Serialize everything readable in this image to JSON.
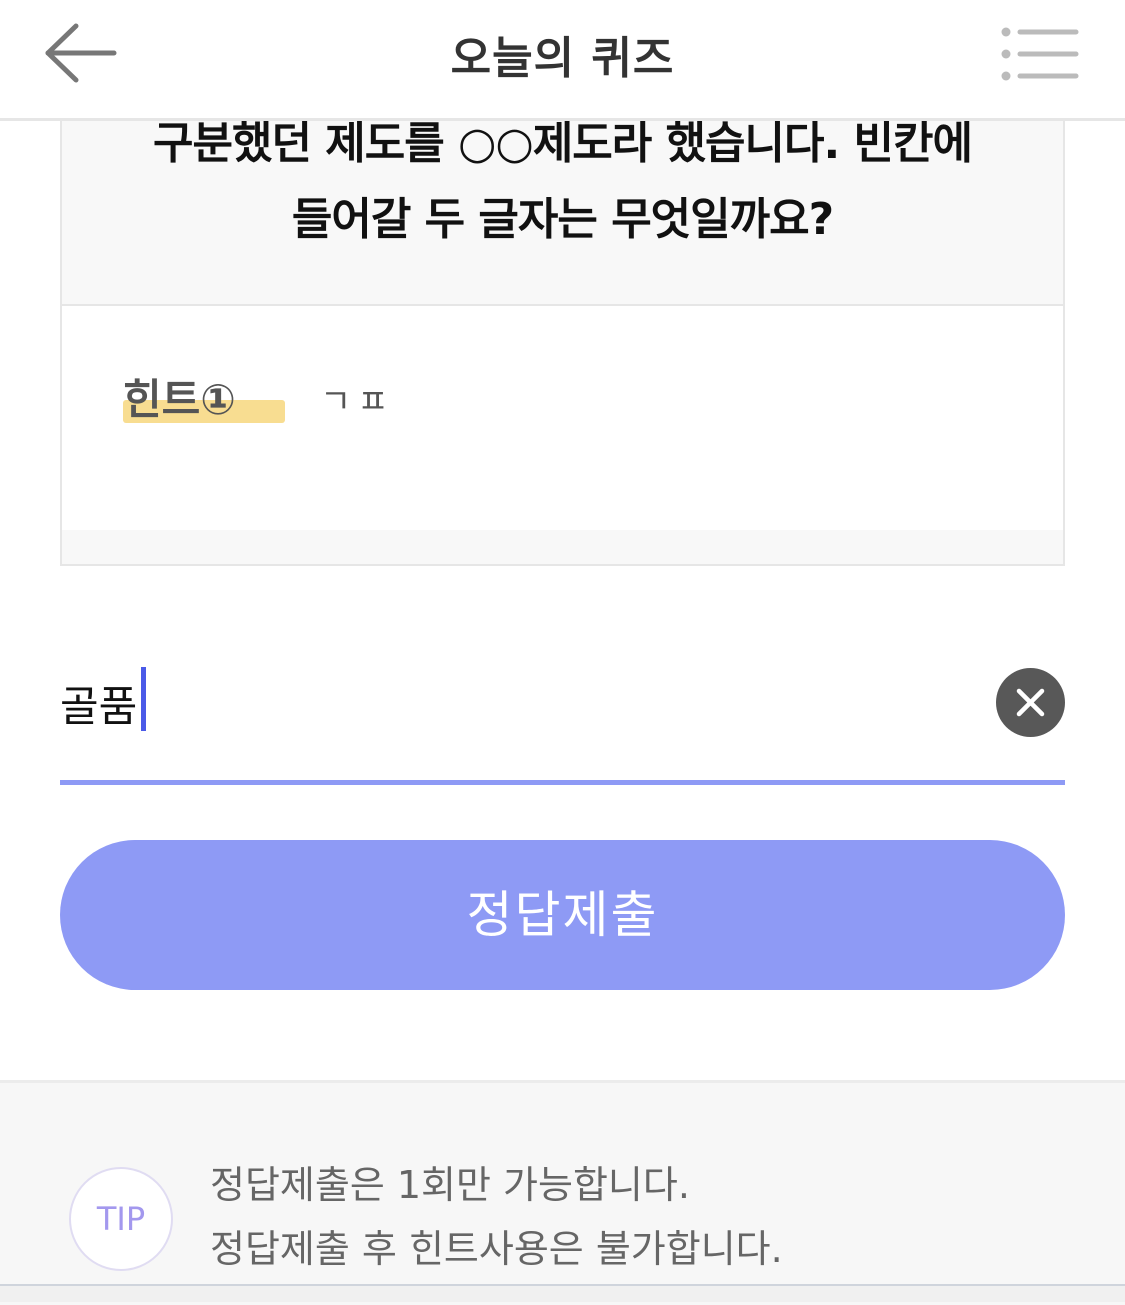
{
  "header": {
    "title": "오늘의 퀴즈",
    "back_icon": "arrow-left-icon",
    "menu_icon": "list-menu-icon"
  },
  "quiz": {
    "question_lines": [
      "구분했던 제도를 ○○제도라 했습니다. 빈칸에",
      "들어갈 두 글자는 무엇일까요?"
    ],
    "hint": {
      "label": "힌트①",
      "value": "ㄱㅍ"
    }
  },
  "answer": {
    "value": "골품",
    "clear_icon": "close-icon"
  },
  "submit": {
    "label": "정답제출"
  },
  "tip": {
    "badge": "TIP",
    "lines": [
      "정답제출은 1회만 가능합니다.",
      "정답제출 후 힌트사용은 불가합니다."
    ]
  },
  "colors": {
    "accent": "#8e9af5",
    "cursor": "#4a5ae8",
    "hint_highlight": "#f8dd91",
    "clear_button": "#585858",
    "tip_badge_text": "#a398ee"
  }
}
